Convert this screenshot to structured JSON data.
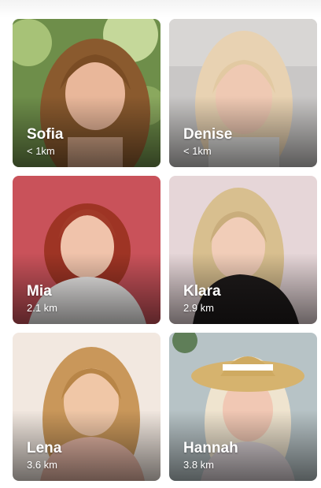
{
  "profiles": [
    {
      "name": "Sofia",
      "distance": "< 1km"
    },
    {
      "name": "Denise",
      "distance": "< 1km"
    },
    {
      "name": "Mia",
      "distance": "2.1 km"
    },
    {
      "name": "Klara",
      "distance": "2.9 km"
    },
    {
      "name": "Lena",
      "distance": "3.6 km"
    },
    {
      "name": "Hannah",
      "distance": "3.8 km"
    }
  ]
}
